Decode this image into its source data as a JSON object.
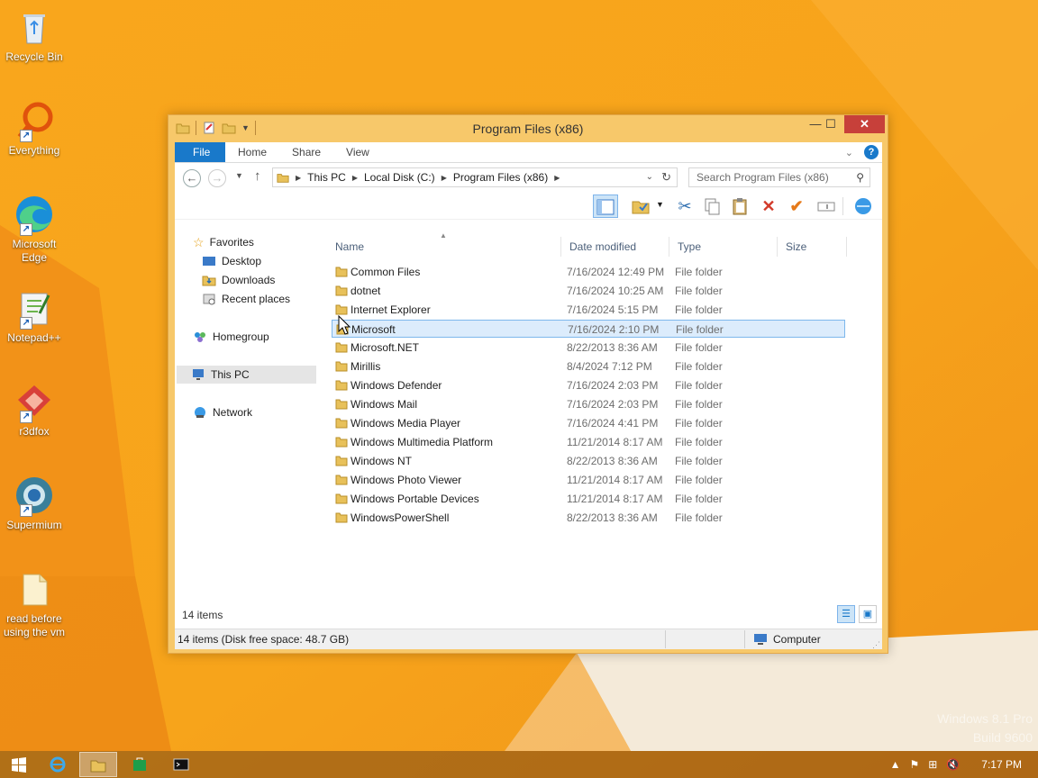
{
  "desktop": {
    "icons": [
      {
        "label": "Recycle Bin",
        "icon": "recycle-bin-icon"
      },
      {
        "label": "Everything",
        "icon": "everything-search-icon"
      },
      {
        "label": "Microsoft Edge",
        "icon": "edge-icon"
      },
      {
        "label": "Notepad++",
        "icon": "notepad-plus-plus-icon"
      },
      {
        "label": "r3dfox",
        "icon": "r3dfox-icon"
      },
      {
        "label": "Supermium",
        "icon": "supermium-icon"
      },
      {
        "label": "read before using the vm",
        "icon": "text-file-icon"
      }
    ],
    "watermark_line1": "Windows 8.1 Pro",
    "watermark_line2": "Build 9600"
  },
  "window": {
    "title": "Program Files (x86)",
    "controls": {
      "minimize": "—",
      "maximize": "☐",
      "close": "✕"
    },
    "ribbon_tabs": [
      "File",
      "Home",
      "Share",
      "View"
    ],
    "address": {
      "crumbs": [
        "This PC",
        "Local Disk (C:)",
        "Program Files (x86)"
      ]
    },
    "search": {
      "placeholder": "Search Program Files (x86)"
    },
    "nav": {
      "favorites": "Favorites",
      "desktop": "Desktop",
      "downloads": "Downloads",
      "recent": "Recent places",
      "homegroup": "Homegroup",
      "thispc": "This PC",
      "network": "Network"
    },
    "columns": {
      "name": "Name",
      "date": "Date modified",
      "type": "Type",
      "size": "Size"
    },
    "files": [
      {
        "name": "Common Files",
        "date": "7/16/2024 12:49 PM",
        "type": "File folder"
      },
      {
        "name": "dotnet",
        "date": "7/16/2024 10:25 AM",
        "type": "File folder"
      },
      {
        "name": "Internet Explorer",
        "date": "7/16/2024 5:15 PM",
        "type": "File folder"
      },
      {
        "name": "Microsoft",
        "date": "7/16/2024 2:10 PM",
        "type": "File folder"
      },
      {
        "name": "Microsoft.NET",
        "date": "8/22/2013 8:36 AM",
        "type": "File folder"
      },
      {
        "name": "Mirillis",
        "date": "8/4/2024 7:12 PM",
        "type": "File folder"
      },
      {
        "name": "Windows Defender",
        "date": "7/16/2024 2:03 PM",
        "type": "File folder"
      },
      {
        "name": "Windows Mail",
        "date": "7/16/2024 2:03 PM",
        "type": "File folder"
      },
      {
        "name": "Windows Media Player",
        "date": "7/16/2024 4:41 PM",
        "type": "File folder"
      },
      {
        "name": "Windows Multimedia Platform",
        "date": "11/21/2014 8:17 AM",
        "type": "File folder"
      },
      {
        "name": "Windows NT",
        "date": "8/22/2013 8:36 AM",
        "type": "File folder"
      },
      {
        "name": "Windows Photo Viewer",
        "date": "11/21/2014 8:17 AM",
        "type": "File folder"
      },
      {
        "name": "Windows Portable Devices",
        "date": "11/21/2014 8:17 AM",
        "type": "File folder"
      },
      {
        "name": "WindowsPowerShell",
        "date": "8/22/2013 8:36 AM",
        "type": "File folder"
      }
    ],
    "selected_index": 3,
    "item_count": "14 items",
    "status_left": "14 items (Disk free space: 48.7 GB)",
    "status_right": "Computer"
  },
  "taskbar": {
    "clock": "7:17 PM"
  },
  "colors": {
    "accent": "#1979ca",
    "selection": "#dcecfc",
    "wallpaper": "#f6a21a"
  }
}
